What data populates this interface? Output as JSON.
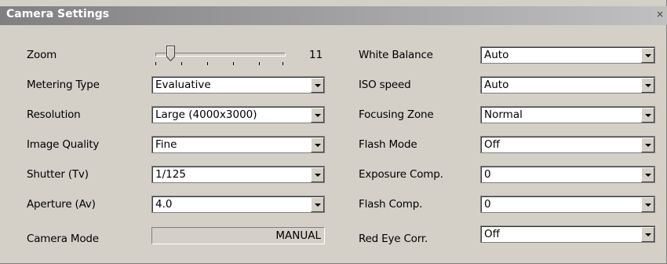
{
  "window": {
    "title": "Camera Settings",
    "close_glyph": "×"
  },
  "zoom": {
    "label": "Zoom",
    "value": "11",
    "level_fraction": 0.09
  },
  "left": {
    "metering": {
      "label": "Metering Type",
      "value": "Evaluative"
    },
    "resolution": {
      "label": "Resolution",
      "value": "Large (4000x3000)"
    },
    "quality": {
      "label": "Image Quality",
      "value": "Fine"
    },
    "shutter": {
      "label": "Shutter (Tv)",
      "value": "1/125"
    },
    "aperture": {
      "label": "Aperture (Av)",
      "value": "4.0"
    },
    "mode": {
      "label": "Camera Mode",
      "value": "MANUAL"
    }
  },
  "right": {
    "white_balance": {
      "label": "White Balance",
      "value": "Auto"
    },
    "iso": {
      "label": "ISO speed",
      "value": "Auto"
    },
    "focus": {
      "label": "Focusing Zone",
      "value": "Normal"
    },
    "flash": {
      "label": "Flash Mode",
      "value": "Off"
    },
    "exposure": {
      "label": "Exposure Comp.",
      "value": "0"
    },
    "flash_comp": {
      "label": "Flash Comp.",
      "value": "0"
    },
    "red_eye": {
      "label": "Red Eye Corr.",
      "value": "Off"
    }
  },
  "icons": {
    "dropdown": "chevron-down-icon",
    "close": "close-icon",
    "slider_thumb": "slider-thumb-icon"
  },
  "colors": {
    "face": "#d4d0c8",
    "titlebar": "#808080",
    "field": "#ffffff"
  }
}
